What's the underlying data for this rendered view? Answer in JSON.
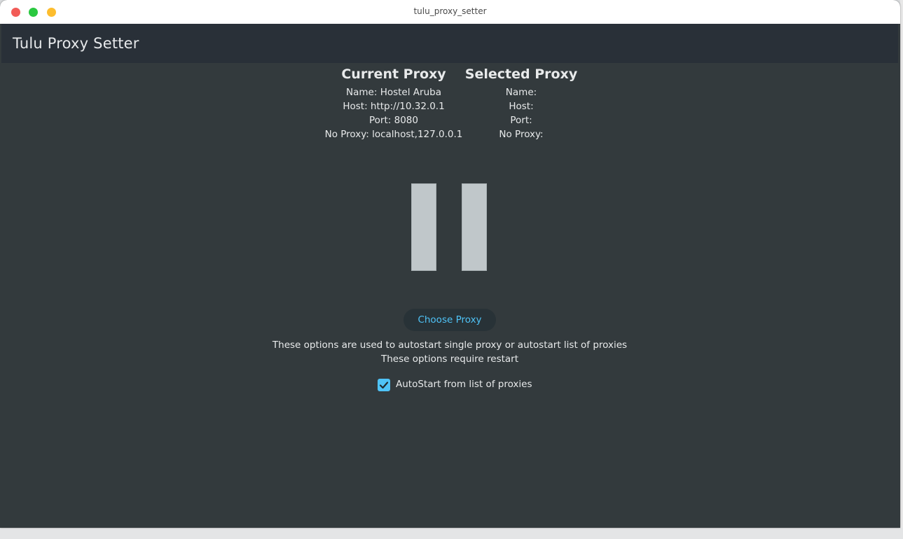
{
  "window": {
    "title": "tulu_proxy_setter"
  },
  "appbar": {
    "title": "Tulu Proxy Setter"
  },
  "current_proxy": {
    "heading": "Current Proxy",
    "name": "Name: Hostel Aruba",
    "host": "Host: http://10.32.0.1",
    "port": "Port: 8080",
    "no_proxy": "No Proxy: localhost,127.0.0.1"
  },
  "selected_proxy": {
    "heading": "Selected Proxy",
    "name": "Name:",
    "host": "Host:",
    "port": "Port:",
    "no_proxy": "No Proxy:"
  },
  "controls": {
    "pause_icon": "pause-icon",
    "choose_button": "Choose Proxy"
  },
  "info": {
    "line1": "These options are used to autostart single proxy or autostart list of proxies",
    "line2": "These options require restart"
  },
  "autostart": {
    "label": "AutoStart from list of proxies",
    "checked": true
  },
  "colors": {
    "background": "#333a3d",
    "appbar": "#293038",
    "accent": "#4fc3f7",
    "pause_bars": "#c0c7ca"
  }
}
